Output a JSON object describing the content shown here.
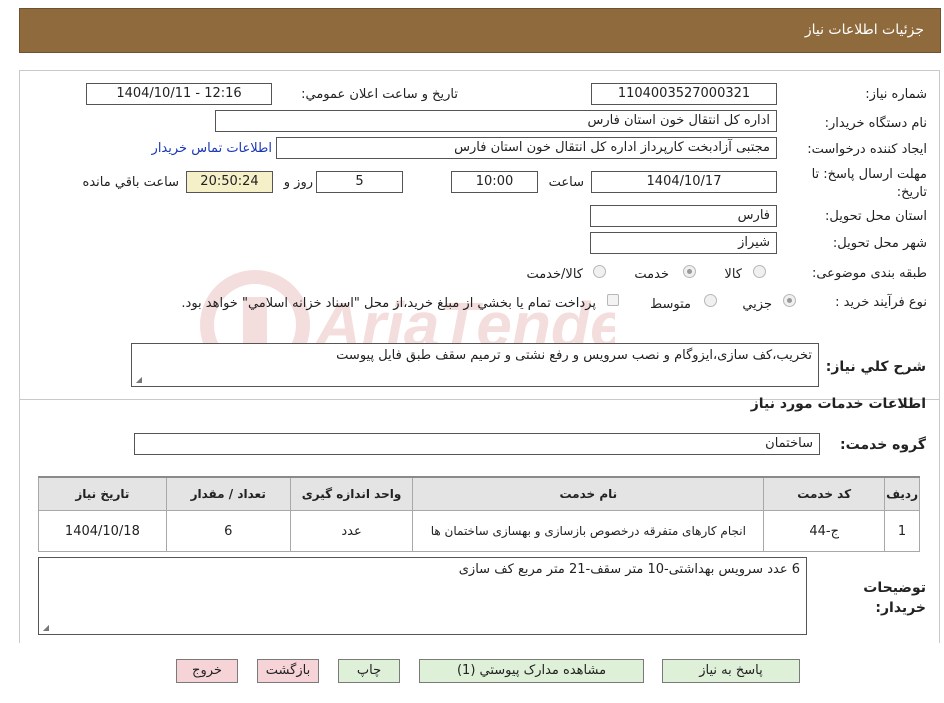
{
  "header": {
    "title": "جزئیات اطلاعات نیاز"
  },
  "fields": {
    "need_number_label": "شماره نیاز:",
    "need_number": "1104003527000321",
    "announce_label": "تاریخ و ساعت اعلان عمومي:",
    "announce_value": "1404/10/11 - 12:16",
    "buyer_org_label": "نام دستگاه خريدار:",
    "buyer_org": "اداره کل انتقال خون استان فارس",
    "requester_label": "ايجاد کننده درخواست:",
    "requester": "مجتبی آزادبخت کارپرداز اداره کل انتقال خون استان فارس",
    "contact_link": "اطلاعات تماس خريدار",
    "deadline_label": "مهلت ارسال پاسخ: تا تاریخ:",
    "deadline_date": "1404/10/17",
    "time_label": "ساعت",
    "deadline_time": "10:00",
    "days_value": "5",
    "days_label": "روز و",
    "remaining_timer": "20:50:24",
    "remaining_label": "ساعت باقي مانده",
    "province_label": "استان محل تحويل:",
    "province": "فارس",
    "city_label": "شهر محل تحويل:",
    "city": "شیراز",
    "category_label": "طبقه بندی موضوعی:",
    "category_options": [
      "کالا",
      "خدمت",
      "کالا/خدمت"
    ],
    "category_selected": "خدمت",
    "process_label": "نوع فرآیند خرید :",
    "process_options": [
      "جزيي",
      "متوسط"
    ],
    "process_selected": "جزيي",
    "payment_note": "پرداخت تمام يا بخشي از مبلغ خريد،از محل \"اسناد خزانه اسلامي\" خواهد بود."
  },
  "description": {
    "label": "شرح کلي نياز:",
    "text": "تخریب،کف سازی،ایزوگام و نصب سرویس و رفع نشتی و ترمیم سقف طبق فایل پیوست"
  },
  "services": {
    "section_title": "اطلاعات خدمات مورد نياز",
    "group_label": "گروه خدمت:",
    "group_value": "ساختمان",
    "columns": [
      "رديف",
      "کد خدمت",
      "نام خدمت",
      "واحد اندازه گيری",
      "تعداد / مقدار",
      "تاریخ نیاز"
    ],
    "rows": [
      [
        "1",
        "ج-44",
        "انجام کارهای متفرقه درخصوص بازسازی و بهسازی ساختمان ها",
        "عدد",
        "6",
        "1404/10/18"
      ]
    ]
  },
  "buyer_notes": {
    "label": "توضيحات خريدار:",
    "text": "6 عدد سرویس بهداشتی-10 متر سقف-21 متر مربع کف سازی"
  },
  "buttons": {
    "reply": "پاسخ به نياز",
    "attachments": "مشاهده مدارک پيوستي (1)",
    "print": "چاپ",
    "back": "بازگشت",
    "exit": "خروج"
  },
  "colors": {
    "header_bg": "#8f6a3c",
    "green_button": "#dff0d8",
    "pink_button": "#f6d3d6",
    "timer_bg": "#f6f0c9",
    "link": "#1a37b8"
  },
  "watermark": {
    "text": "AriaTender.neT"
  }
}
